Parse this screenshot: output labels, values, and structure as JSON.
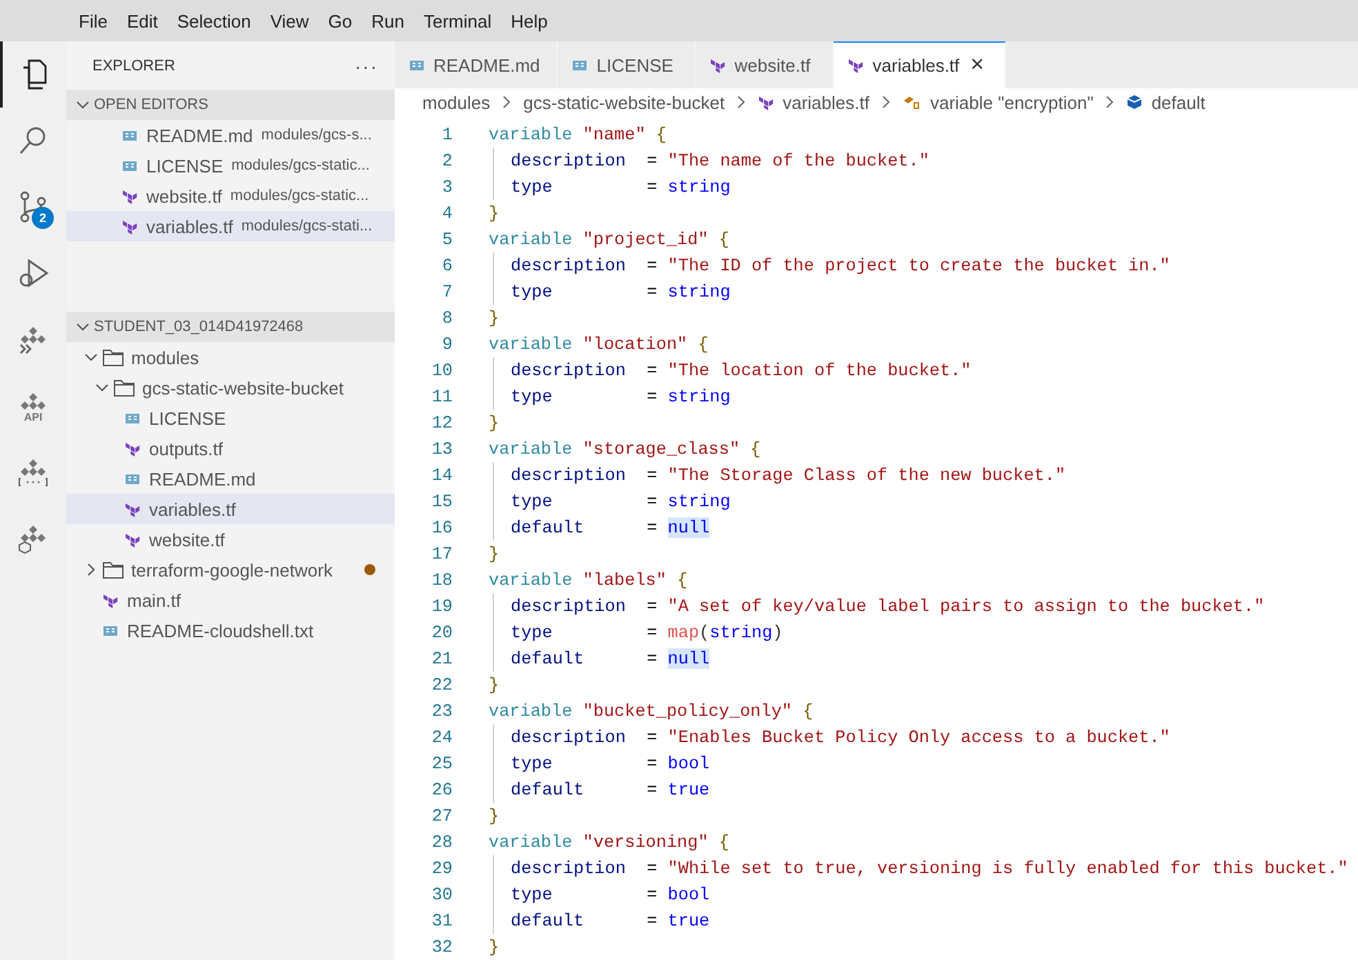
{
  "menu": [
    "File",
    "Edit",
    "Selection",
    "View",
    "Go",
    "Run",
    "Terminal",
    "Help"
  ],
  "activity_bar": [
    {
      "kind": "files",
      "selected": true
    },
    {
      "kind": "search",
      "selected": false
    },
    {
      "kind": "source-control",
      "selected": false,
      "badge": "2"
    },
    {
      "kind": "run-debug",
      "selected": false
    },
    {
      "kind": "cloud-run",
      "selected": false
    },
    {
      "kind": "cloud-api",
      "selected": false,
      "label": "API"
    },
    {
      "kind": "cloud-secret",
      "selected": false
    },
    {
      "kind": "cloud-k8s",
      "selected": false
    }
  ],
  "explorer": {
    "title": "EXPLORER",
    "more": "···",
    "open_editors": {
      "title": "OPEN EDITORS",
      "expanded": true,
      "items": [
        {
          "kind": "doc",
          "name": "README.md",
          "path": "modules/gcs-s...",
          "selected": false
        },
        {
          "kind": "doc",
          "name": "LICENSE",
          "path": "modules/gcs-static...",
          "selected": false
        },
        {
          "kind": "terraform",
          "name": "website.tf",
          "path": "modules/gcs-static...",
          "selected": false
        },
        {
          "kind": "terraform",
          "name": "variables.tf",
          "path": "modules/gcs-stati...",
          "selected": true
        }
      ]
    },
    "workspace": {
      "title": "STUDENT_03_014D41972468",
      "expanded": true,
      "tree": [
        {
          "kind": "folder",
          "name": "modules",
          "expanded": true,
          "selected": false,
          "children": [
            {
              "kind": "folder",
              "name": "gcs-static-website-bucket",
              "expanded": true,
              "selected": false,
              "children": [
                {
                  "kind": "doc",
                  "name": "LICENSE",
                  "selected": false
                },
                {
                  "kind": "terraform",
                  "name": "outputs.tf",
                  "selected": false
                },
                {
                  "kind": "doc",
                  "name": "README.md",
                  "selected": false
                },
                {
                  "kind": "terraform",
                  "name": "variables.tf",
                  "selected": true
                },
                {
                  "kind": "terraform",
                  "name": "website.tf",
                  "selected": false
                }
              ]
            }
          ]
        },
        {
          "kind": "folder",
          "name": "terraform-google-network",
          "expanded": false,
          "selected": false,
          "modified": true,
          "color": "#9b5b00"
        },
        {
          "kind": "terraform",
          "name": "main.tf",
          "selected": false
        },
        {
          "kind": "doc",
          "name": "README-cloudshell.txt",
          "selected": false
        }
      ]
    }
  },
  "tabs": [
    {
      "kind": "doc",
      "label": "README.md",
      "selected": false
    },
    {
      "kind": "doc",
      "label": "LICENSE",
      "selected": false
    },
    {
      "kind": "terraform",
      "label": "website.tf",
      "selected": false
    },
    {
      "kind": "terraform",
      "label": "variables.tf",
      "selected": true,
      "close": "×"
    }
  ],
  "breadcrumbs": [
    {
      "kind": "folder",
      "label": "modules"
    },
    {
      "kind": "folder",
      "label": "gcs-static-website-bucket"
    },
    {
      "kind": "terraform",
      "label": "variables.tf"
    },
    {
      "kind": "variable",
      "label": "variable \"encryption\""
    },
    {
      "kind": "field",
      "label": "default"
    }
  ],
  "code": [
    {
      "number": "1",
      "kind": "header",
      "keyword": "variable",
      "name": "\"name\"",
      "brace": "{"
    },
    {
      "number": "2",
      "kind": "attr",
      "key": "description",
      "op": "=",
      "value": [
        {
          "kind": "string",
          "text": "\"The name of the bucket.\"",
          "highlighted": false
        }
      ]
    },
    {
      "number": "3",
      "kind": "attr",
      "key": "type",
      "op": "=",
      "value": [
        {
          "kind": "constant",
          "text": "string",
          "highlighted": false
        }
      ]
    },
    {
      "number": "4",
      "kind": "close",
      "brace": "}"
    },
    {
      "number": "5",
      "kind": "header",
      "keyword": "variable",
      "name": "\"project_id\"",
      "brace": "{"
    },
    {
      "number": "6",
      "kind": "attr",
      "key": "description",
      "op": "=",
      "value": [
        {
          "kind": "string",
          "text": "\"The ID of the project to create the bucket in.\"",
          "highlighted": false
        }
      ]
    },
    {
      "number": "7",
      "kind": "attr",
      "key": "type",
      "op": "=",
      "value": [
        {
          "kind": "constant",
          "text": "string",
          "highlighted": false
        }
      ]
    },
    {
      "number": "8",
      "kind": "close",
      "brace": "}"
    },
    {
      "number": "9",
      "kind": "header",
      "keyword": "variable",
      "name": "\"location\"",
      "brace": "{"
    },
    {
      "number": "10",
      "kind": "attr",
      "key": "description",
      "op": "=",
      "value": [
        {
          "kind": "string",
          "text": "\"The location of the bucket.\"",
          "highlighted": false
        }
      ]
    },
    {
      "number": "11",
      "kind": "attr",
      "key": "type",
      "op": "=",
      "value": [
        {
          "kind": "constant",
          "text": "string",
          "highlighted": false
        }
      ]
    },
    {
      "number": "12",
      "kind": "close",
      "brace": "}"
    },
    {
      "number": "13",
      "kind": "header",
      "keyword": "variable",
      "name": "\"storage_class\"",
      "brace": "{"
    },
    {
      "number": "14",
      "kind": "attr",
      "key": "description",
      "op": "=",
      "value": [
        {
          "kind": "string",
          "text": "\"The Storage Class of the new bucket.\"",
          "highlighted": false
        }
      ]
    },
    {
      "number": "15",
      "kind": "attr",
      "key": "type",
      "op": "=",
      "value": [
        {
          "kind": "constant",
          "text": "string",
          "highlighted": false
        }
      ]
    },
    {
      "number": "16",
      "kind": "attr",
      "key": "default",
      "op": "=",
      "value": [
        {
          "kind": "constant",
          "text": "null",
          "highlighted": true
        }
      ]
    },
    {
      "number": "17",
      "kind": "close",
      "brace": "}"
    },
    {
      "number": "18",
      "kind": "header",
      "keyword": "variable",
      "name": "\"labels\"",
      "brace": "{"
    },
    {
      "number": "19",
      "kind": "attr",
      "key": "description",
      "op": "=",
      "value": [
        {
          "kind": "string",
          "text": "\"A set of key/value label pairs to assign to the bucket.\"",
          "highlighted": false
        }
      ]
    },
    {
      "number": "20",
      "kind": "attr",
      "key": "type",
      "op": "=",
      "value": [
        {
          "kind": "function",
          "text": "map",
          "highlighted": false
        },
        {
          "kind": "punct",
          "text": "(",
          "highlighted": false
        },
        {
          "kind": "constant",
          "text": "string",
          "highlighted": false
        },
        {
          "kind": "punct",
          "text": ")",
          "highlighted": false
        }
      ]
    },
    {
      "number": "21",
      "kind": "attr",
      "key": "default",
      "op": "=",
      "value": [
        {
          "kind": "constant",
          "text": "null",
          "highlighted": true
        }
      ]
    },
    {
      "number": "22",
      "kind": "close",
      "brace": "}"
    },
    {
      "number": "23",
      "kind": "header",
      "keyword": "variable",
      "name": "\"bucket_policy_only\"",
      "brace": "{"
    },
    {
      "number": "24",
      "kind": "attr",
      "key": "description",
      "op": "=",
      "value": [
        {
          "kind": "string",
          "text": "\"Enables Bucket Policy Only access to a bucket.\"",
          "highlighted": false
        }
      ]
    },
    {
      "number": "25",
      "kind": "attr",
      "key": "type",
      "op": "=",
      "value": [
        {
          "kind": "constant",
          "text": "bool",
          "highlighted": false
        }
      ]
    },
    {
      "number": "26",
      "kind": "attr",
      "key": "default",
      "op": "=",
      "value": [
        {
          "kind": "constant",
          "text": "true",
          "highlighted": false
        }
      ]
    },
    {
      "number": "27",
      "kind": "close",
      "brace": "}"
    },
    {
      "number": "28",
      "kind": "header",
      "keyword": "variable",
      "name": "\"versioning\"",
      "brace": "{"
    },
    {
      "number": "29",
      "kind": "attr",
      "key": "description",
      "op": "=",
      "value": [
        {
          "kind": "string",
          "text": "\"While set to true, versioning is fully enabled for this bucket.\"",
          "highlighted": false
        }
      ]
    },
    {
      "number": "30",
      "kind": "attr",
      "key": "type",
      "op": "=",
      "value": [
        {
          "kind": "constant",
          "text": "bool",
          "highlighted": false
        }
      ]
    },
    {
      "number": "31",
      "kind": "attr",
      "key": "default",
      "op": "=",
      "value": [
        {
          "kind": "constant",
          "text": "true",
          "highlighted": false
        }
      ]
    },
    {
      "number": "32",
      "kind": "close",
      "brace": "}"
    }
  ]
}
